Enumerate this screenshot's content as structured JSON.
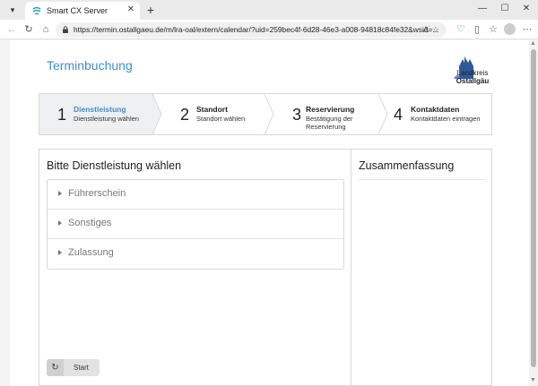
{
  "browser": {
    "tab_title": "Smart CX Server",
    "tab_close": "✕",
    "new_tab": "+",
    "url": "https://termin.ostallgaeu.de/m/lra-oal/extern/calendar/?uid=259bec4f-6d28-46e3-a008-94818c84fe32&wsid=...",
    "window_min": "—",
    "window_max": "☐",
    "window_close": "✕",
    "accent_color": "#1a73e8"
  },
  "page": {
    "title": "Terminbuchung",
    "logo": {
      "line1": "Landkreis",
      "line2": "Ostallgäu"
    },
    "brand_color": "#3b8ed8"
  },
  "steps": [
    {
      "num": "1",
      "title": "Dienstleistung",
      "subtitle": "Dienstleistung wählen",
      "active": true
    },
    {
      "num": "2",
      "title": "Standort",
      "subtitle": "Standort wählen",
      "active": false
    },
    {
      "num": "3",
      "title": "Reservierung",
      "subtitle": "Bestätigung der Reservierung",
      "active": false
    },
    {
      "num": "4",
      "title": "Kontaktdaten",
      "subtitle": "Kontaktdaten eintragen",
      "active": false
    }
  ],
  "services": {
    "heading": "Bitte Dienstleistung wählen",
    "items": [
      {
        "label": "Führerschein"
      },
      {
        "label": "Sonstiges"
      },
      {
        "label": "Zulassung"
      }
    ]
  },
  "summary": {
    "heading": "Zusammenfassung"
  },
  "start_button": {
    "label": "Start",
    "icon": "restart-icon"
  }
}
